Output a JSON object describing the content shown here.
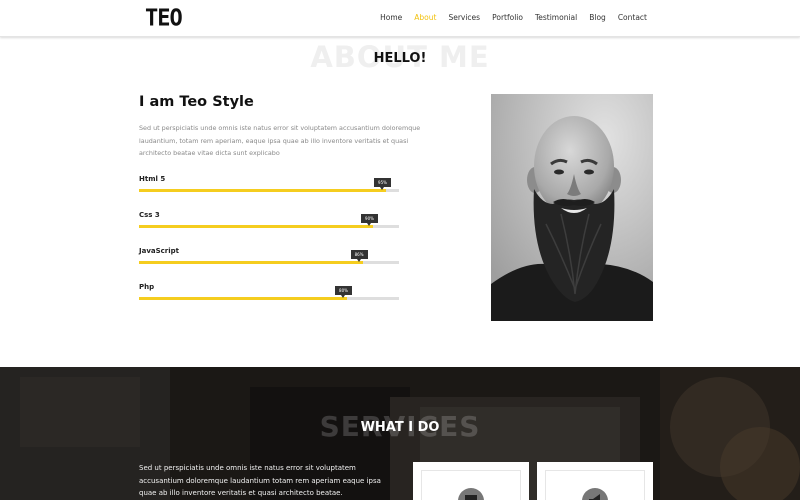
{
  "header": {
    "logo": "TEO",
    "nav": [
      "Home",
      "About",
      "Services",
      "Portfolio",
      "Testimonial",
      "Blog",
      "Contact"
    ],
    "active_nav": "About",
    "accent_color": "#f5cd1f"
  },
  "about": {
    "bg_title": "ABOUT ME",
    "title": "HELLO!",
    "heading": "I am Teo Style",
    "description": "Sed ut perspiciatis unde omnis iste natus error sit voluptatem accusantium doloremque laudantium, totam rem aperiam, eaque ipsa quae ab illo inventore veritatis et quasi architecto beatae vitae dicta sunt explicabo",
    "skills": [
      {
        "label": "Html 5",
        "percent": 95,
        "tip": "95%"
      },
      {
        "label": "Css 3",
        "percent": 90,
        "tip": "90%"
      },
      {
        "label": "JavaScript",
        "percent": 86,
        "tip": "86%"
      },
      {
        "label": "Php",
        "percent": 80,
        "tip": "80%"
      }
    ]
  },
  "services": {
    "bg_title": "SERVICES",
    "title": "WHAT I DO",
    "description": "Sed ut perspiciatis unde omnis iste natus error sit voluptatem accusantium doloremque laudantium totam rem aperiam eaque ipsa quae ab illo inventore veritatis et quasi architecto beatae.",
    "cards": [
      {
        "icon": "laptop-icon"
      },
      {
        "icon": "megaphone-icon"
      }
    ]
  }
}
